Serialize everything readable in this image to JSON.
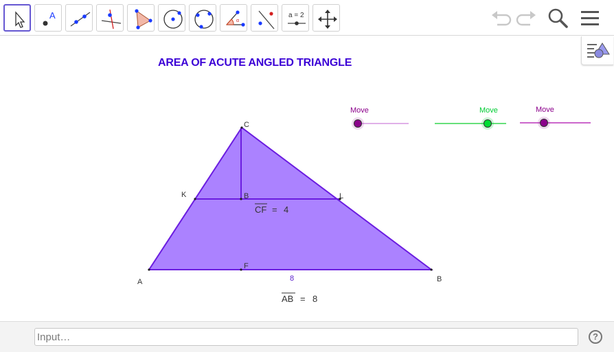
{
  "toolbar": {
    "tools": [
      {
        "icon": "move-arrow-icon"
      },
      {
        "icon": "point-icon",
        "glyph": "A"
      },
      {
        "icon": "line-icon"
      },
      {
        "icon": "perpendicular-line-icon"
      },
      {
        "icon": "polygon-icon"
      },
      {
        "icon": "circle-center-icon"
      },
      {
        "icon": "circle-three-points-icon"
      },
      {
        "icon": "angle-icon"
      },
      {
        "icon": "reflect-icon"
      },
      {
        "icon": "slider-icon",
        "glyph": "a = 2"
      },
      {
        "icon": "move-graphics-view-icon"
      }
    ],
    "right": [
      "undo-icon",
      "redo-icon",
      "search-icon",
      "menu-icon"
    ]
  },
  "graphics": {
    "title": "AREA OF ACUTE ANGLED TRIANGLE",
    "triangle_color": "#a77bff",
    "edge_color": "#6b1de0",
    "points": {
      "A": "A",
      "B": "B",
      "C": "C",
      "K": "K",
      "L": "L",
      "F": "F",
      "Bmid": "B"
    },
    "measure_ab_side": "8",
    "cf_label": "CF",
    "cf_value": "4",
    "ab_label": "AB",
    "ab_value": "8",
    "equals": "="
  },
  "sliders": [
    {
      "label": "Move",
      "color": "#8b008b",
      "track": "#e0b0e8",
      "value": 0.0
    },
    {
      "label": "Move",
      "color": "#00cc33",
      "track": "#66e07a",
      "value": 0.75
    },
    {
      "label": "Move",
      "color": "#8b008b",
      "track": "#cc66cc",
      "value": 0.35
    }
  ],
  "input": {
    "placeholder": "Input…"
  },
  "help": "?"
}
